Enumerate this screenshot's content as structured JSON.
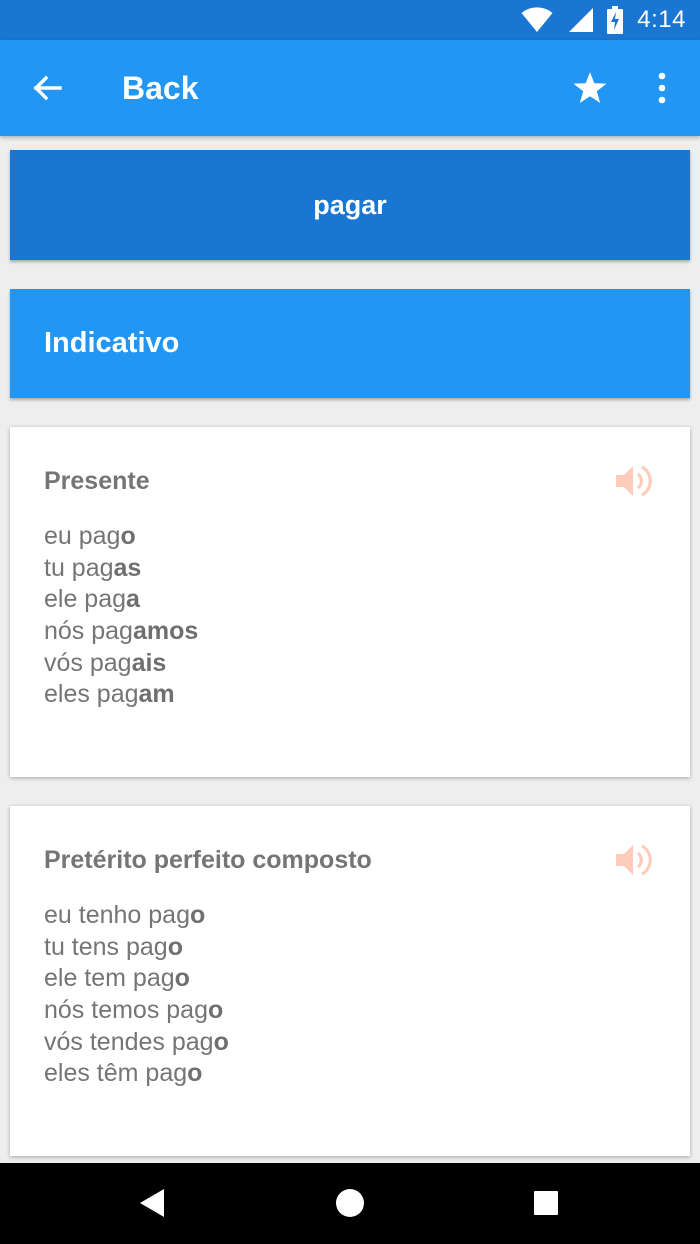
{
  "status_bar": {
    "time": "4:14"
  },
  "app_bar": {
    "title": "Back"
  },
  "verb": "pagar",
  "mood": "Indicativo",
  "tenses": [
    {
      "title": "Presente",
      "rows": [
        {
          "stem": "eu pag",
          "ending": "o"
        },
        {
          "stem": "tu pag",
          "ending": "as"
        },
        {
          "stem": "ele pag",
          "ending": "a"
        },
        {
          "stem": "nós pag",
          "ending": "amos"
        },
        {
          "stem": "vós pag",
          "ending": "ais"
        },
        {
          "stem": "eles pag",
          "ending": "am"
        }
      ]
    },
    {
      "title": "Pretérito perfeito composto",
      "rows": [
        {
          "stem": "eu tenho pag",
          "ending": "o"
        },
        {
          "stem": "tu tens pag",
          "ending": "o"
        },
        {
          "stem": "ele tem pag",
          "ending": "o"
        },
        {
          "stem": "nós temos pag",
          "ending": "o"
        },
        {
          "stem": "vós tendes pag",
          "ending": "o"
        },
        {
          "stem": "eles têm pag",
          "ending": "o"
        }
      ]
    }
  ],
  "colors": {
    "status_bar": "#1976d2",
    "app_bar": "#2196f3",
    "verb_header": "#1976d2",
    "mood_header": "#2196f3",
    "speaker_icon": "#ffccbc"
  },
  "icons": [
    "wifi-icon",
    "signal-icon",
    "battery-icon",
    "back-arrow-icon",
    "star-icon",
    "more-vert-icon",
    "speaker-icon",
    "nav-back-icon",
    "nav-home-icon",
    "nav-recents-icon"
  ]
}
